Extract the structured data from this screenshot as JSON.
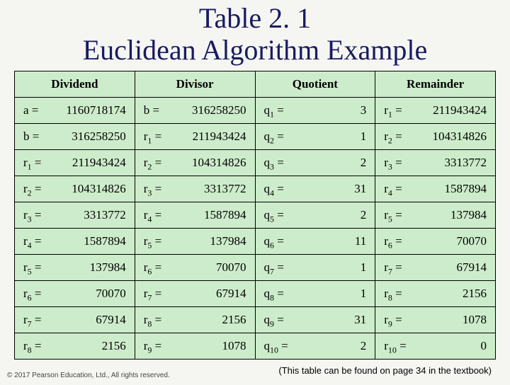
{
  "title_line1": "Table 2. 1",
  "title_line2": "Euclidean Algorithm Example",
  "headers": [
    "Dividend",
    "Divisor",
    "Quotient",
    "Remainder"
  ],
  "rows": [
    {
      "dividend": {
        "pre": "a",
        "sub": "",
        "val": "1160718174"
      },
      "divisor": {
        "pre": "b",
        "sub": "",
        "val": "316258250"
      },
      "quotient": {
        "pre": "q",
        "sub": "1",
        "val": "3"
      },
      "remainder": {
        "pre": "r",
        "sub": "1",
        "val": "211943424"
      }
    },
    {
      "dividend": {
        "pre": "b",
        "sub": "",
        "val": "316258250"
      },
      "divisor": {
        "pre": "r",
        "sub": "1",
        "val": "211943424"
      },
      "quotient": {
        "pre": "q",
        "sub": "2",
        "val": "1"
      },
      "remainder": {
        "pre": "r",
        "sub": "2",
        "val": "104314826"
      }
    },
    {
      "dividend": {
        "pre": "r",
        "sub": "1",
        "val": "211943424"
      },
      "divisor": {
        "pre": "r",
        "sub": "2",
        "val": "104314826"
      },
      "quotient": {
        "pre": "q",
        "sub": "3",
        "val": "2"
      },
      "remainder": {
        "pre": "r",
        "sub": "3",
        "val": "3313772"
      }
    },
    {
      "dividend": {
        "pre": "r",
        "sub": "2",
        "val": "104314826"
      },
      "divisor": {
        "pre": "r",
        "sub": "3",
        "val": "3313772"
      },
      "quotient": {
        "pre": "q",
        "sub": "4",
        "val": "31"
      },
      "remainder": {
        "pre": "r",
        "sub": "4",
        "val": "1587894"
      }
    },
    {
      "dividend": {
        "pre": "r",
        "sub": "3",
        "val": "3313772"
      },
      "divisor": {
        "pre": "r",
        "sub": "4",
        "val": "1587894"
      },
      "quotient": {
        "pre": "q",
        "sub": "5",
        "val": "2"
      },
      "remainder": {
        "pre": "r",
        "sub": "5",
        "val": "137984"
      }
    },
    {
      "dividend": {
        "pre": "r",
        "sub": "4",
        "val": "1587894"
      },
      "divisor": {
        "pre": "r",
        "sub": "5",
        "val": "137984"
      },
      "quotient": {
        "pre": "q",
        "sub": "6",
        "val": "11"
      },
      "remainder": {
        "pre": "r",
        "sub": "6",
        "val": "70070"
      }
    },
    {
      "dividend": {
        "pre": "r",
        "sub": "5",
        "val": "137984"
      },
      "divisor": {
        "pre": "r",
        "sub": "6",
        "val": "70070"
      },
      "quotient": {
        "pre": "q",
        "sub": "7",
        "val": "1"
      },
      "remainder": {
        "pre": "r",
        "sub": "7",
        "val": "67914"
      }
    },
    {
      "dividend": {
        "pre": "r",
        "sub": "6",
        "val": "70070"
      },
      "divisor": {
        "pre": "r",
        "sub": "7",
        "val": "67914"
      },
      "quotient": {
        "pre": "q",
        "sub": "8",
        "val": "1"
      },
      "remainder": {
        "pre": "r",
        "sub": "8",
        "val": "2156"
      }
    },
    {
      "dividend": {
        "pre": "r",
        "sub": "7",
        "val": "67914"
      },
      "divisor": {
        "pre": "r",
        "sub": "8",
        "val": "2156"
      },
      "quotient": {
        "pre": "q",
        "sub": "9",
        "val": "31"
      },
      "remainder": {
        "pre": "r",
        "sub": "9",
        "val": "1078"
      }
    },
    {
      "dividend": {
        "pre": "r",
        "sub": "8",
        "val": "2156"
      },
      "divisor": {
        "pre": "r",
        "sub": "9",
        "val": "1078"
      },
      "quotient": {
        "pre": "q",
        "sub": "10",
        "val": "2"
      },
      "remainder": {
        "pre": "r",
        "sub": "10",
        "val": "0"
      }
    }
  ],
  "caption": "(This table can be found on page 34 in the textbook)",
  "copyright": "© 2017 Pearson Education, Ltd., All rights reserved."
}
